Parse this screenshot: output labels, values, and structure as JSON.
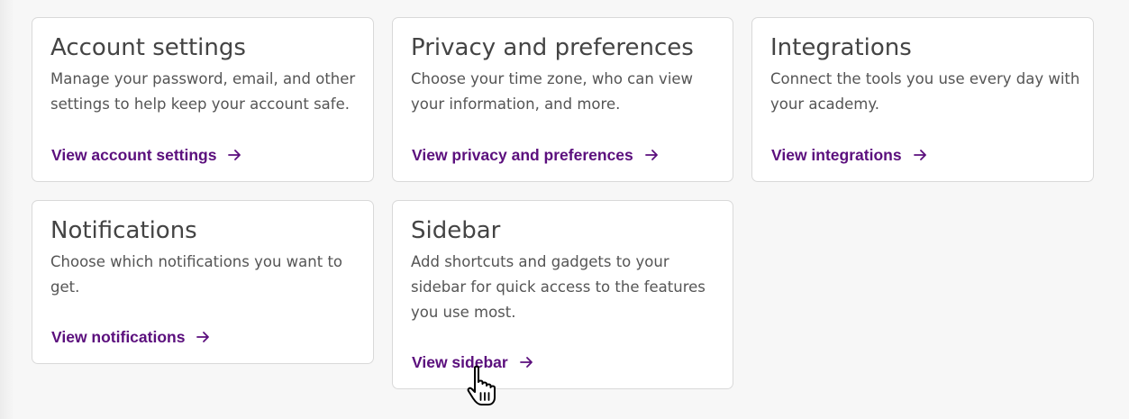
{
  "cards": [
    {
      "title": "Account settings",
      "description": "Manage your password, email, and other settings to help keep your account safe.",
      "link": "View account settings"
    },
    {
      "title": "Privacy and preferences",
      "description": "Choose your time zone, who can view your information, and more.",
      "link": "View privacy and preferences"
    },
    {
      "title": "Integrations",
      "description": "Connect the tools you use every day with your academy.",
      "link": "View integrations"
    },
    {
      "title": "Notifications",
      "description": "Choose which notifications you want to get.",
      "link": "View notifications"
    },
    {
      "title": "Sidebar",
      "description": "Add shortcuts and gadgets to your sidebar for quick access to the features you use most.",
      "link": "View sidebar"
    }
  ],
  "icons": {
    "link_arrow": "arrow-right-icon",
    "cursor": "hand-pointer-cursor-icon"
  },
  "colors": {
    "link": "#5b0f7d",
    "title": "#444444",
    "description": "#555555",
    "card_border": "#d9d9d9",
    "background": "#f7f7f7"
  }
}
